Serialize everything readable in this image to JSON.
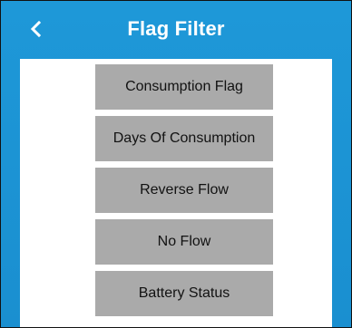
{
  "header": {
    "title": "Flag Filter",
    "back_icon": "chevron-left-icon"
  },
  "filters": [
    {
      "label": "Consumption Flag"
    },
    {
      "label": "Days Of Consumption"
    },
    {
      "label": "Reverse Flow"
    },
    {
      "label": "No Flow"
    },
    {
      "label": "Battery Status"
    }
  ],
  "colors": {
    "header_bg": "#1e98d8",
    "panel_bg": "#ffffff",
    "button_bg": "#aaaaaa",
    "button_text": "#121212",
    "title_text": "#ffffff"
  }
}
